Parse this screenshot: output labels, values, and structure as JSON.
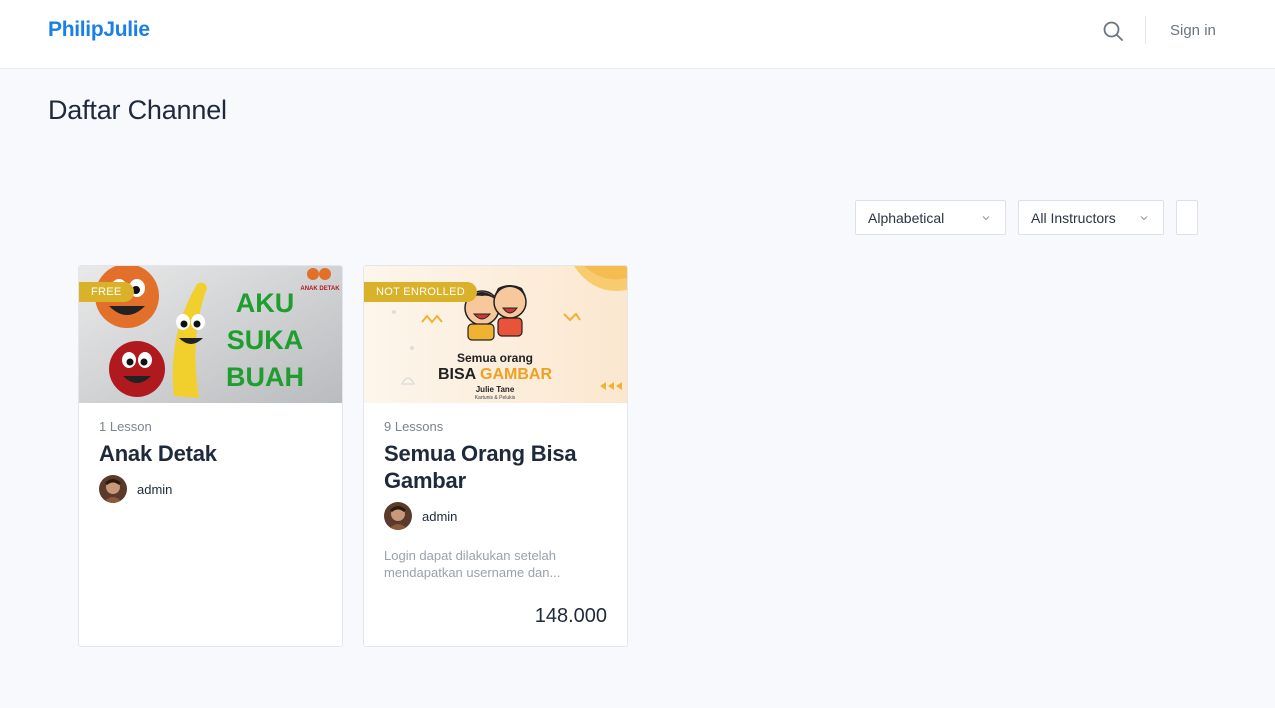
{
  "header": {
    "logo": "PhilipJulie",
    "search_icon": "search-icon",
    "signin_label": "Sign in"
  },
  "page": {
    "title": "Daftar Channel"
  },
  "filters": {
    "sort_selected": "Alphabetical",
    "instructor_selected": "All Instructors",
    "chevron_icon": "chevron-down-icon"
  },
  "courses": [
    {
      "badge": "FREE",
      "lessons": "1 Lesson",
      "title": "Anak Detak",
      "author": "admin",
      "thumb_text": [
        "AKU",
        "SUKA",
        "BUAH"
      ],
      "thumb_logo": "ANAK DETAK"
    },
    {
      "badge": "NOT ENROLLED",
      "lessons": "9 Lessons",
      "title": "Semua Orang Bisa Gambar",
      "author": "admin",
      "description": "Login dapat dilakukan setelah mendapatkan username dan...",
      "price": "148.000",
      "thumb_line1": "Semua orang",
      "thumb_line2a": "BISA ",
      "thumb_line2b": "GAMBAR",
      "thumb_author": "Julie Tane",
      "thumb_sub": "Kartunis & Pelukis"
    }
  ],
  "colors": {
    "brand": "#1a7fe6",
    "badge": "#d9b22a",
    "background": "#f7f9fc"
  }
}
